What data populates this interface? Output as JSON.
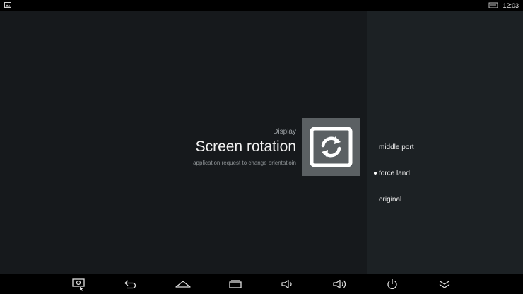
{
  "status_bar": {
    "time": "12:03",
    "left_icon": "image-icon",
    "right_icon": "ethernet-icon"
  },
  "settings_item": {
    "category": "Display",
    "title": "Screen rotation",
    "description": "application request to change orientatioin",
    "icon": "screen-rotation-icon"
  },
  "options": [
    {
      "label": "middle port",
      "selected": false
    },
    {
      "label": "force land",
      "selected": true
    },
    {
      "label": "original",
      "selected": false
    }
  ],
  "nav_bar": {
    "buttons": [
      "screenshot-icon",
      "back-icon",
      "home-icon",
      "recent-apps-icon",
      "volume-down-icon",
      "volume-up-icon",
      "power-icon",
      "collapse-icon"
    ]
  },
  "colors": {
    "background": "#16191c",
    "panel": "#1c2124",
    "tile": "#5b6063"
  }
}
